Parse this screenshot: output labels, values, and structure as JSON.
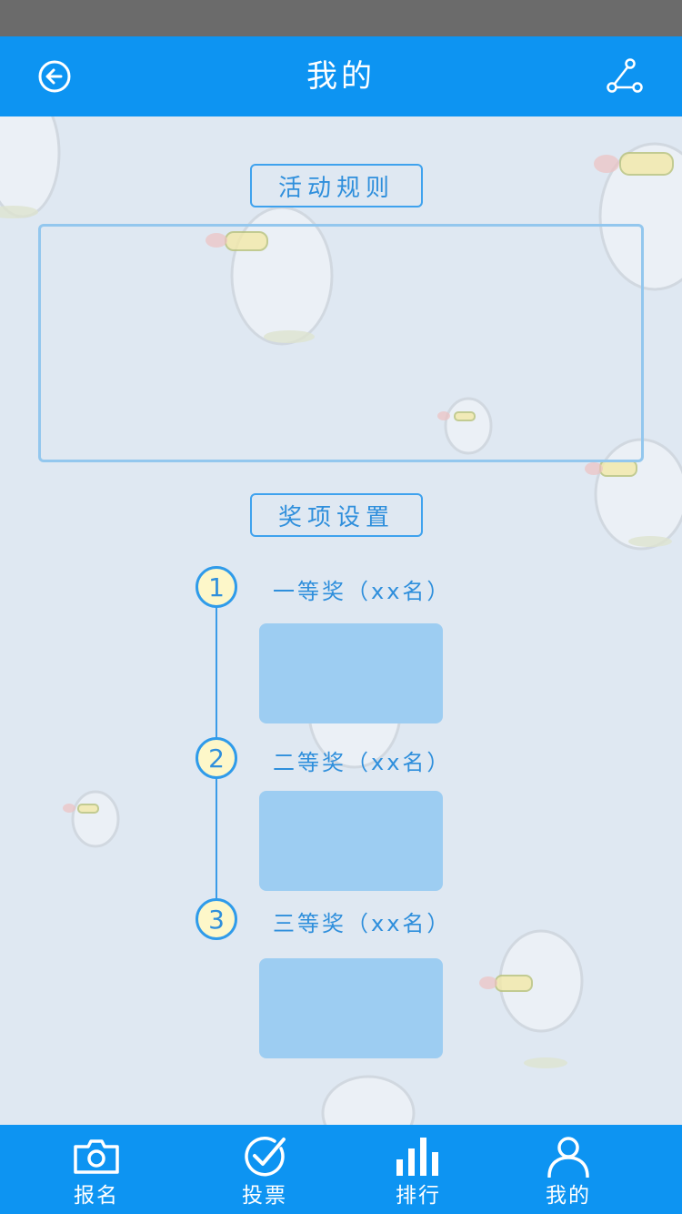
{
  "header": {
    "title": "我的",
    "back_icon": "back-arrow-icon",
    "share_icon": "share-icon"
  },
  "rules": {
    "label": "活动规则"
  },
  "awards": {
    "label": "奖项设置",
    "items": [
      {
        "number": "1",
        "title": "一等奖（xx名）"
      },
      {
        "number": "2",
        "title": "二等奖（xx名）"
      },
      {
        "number": "3",
        "title": "三等奖（xx名）"
      }
    ]
  },
  "tabs": [
    {
      "label": "报名",
      "icon": "camera-icon"
    },
    {
      "label": "投票",
      "icon": "check-circle-icon"
    },
    {
      "label": "排行",
      "icon": "bar-chart-icon"
    },
    {
      "label": "我的",
      "icon": "user-icon"
    }
  ],
  "colors": {
    "primary": "#0d94f2",
    "background": "#dfe8f2",
    "accent_text": "#2f8fdc",
    "placeholder": "#9dcdf2",
    "badge_fill": "#fdf7c9"
  }
}
